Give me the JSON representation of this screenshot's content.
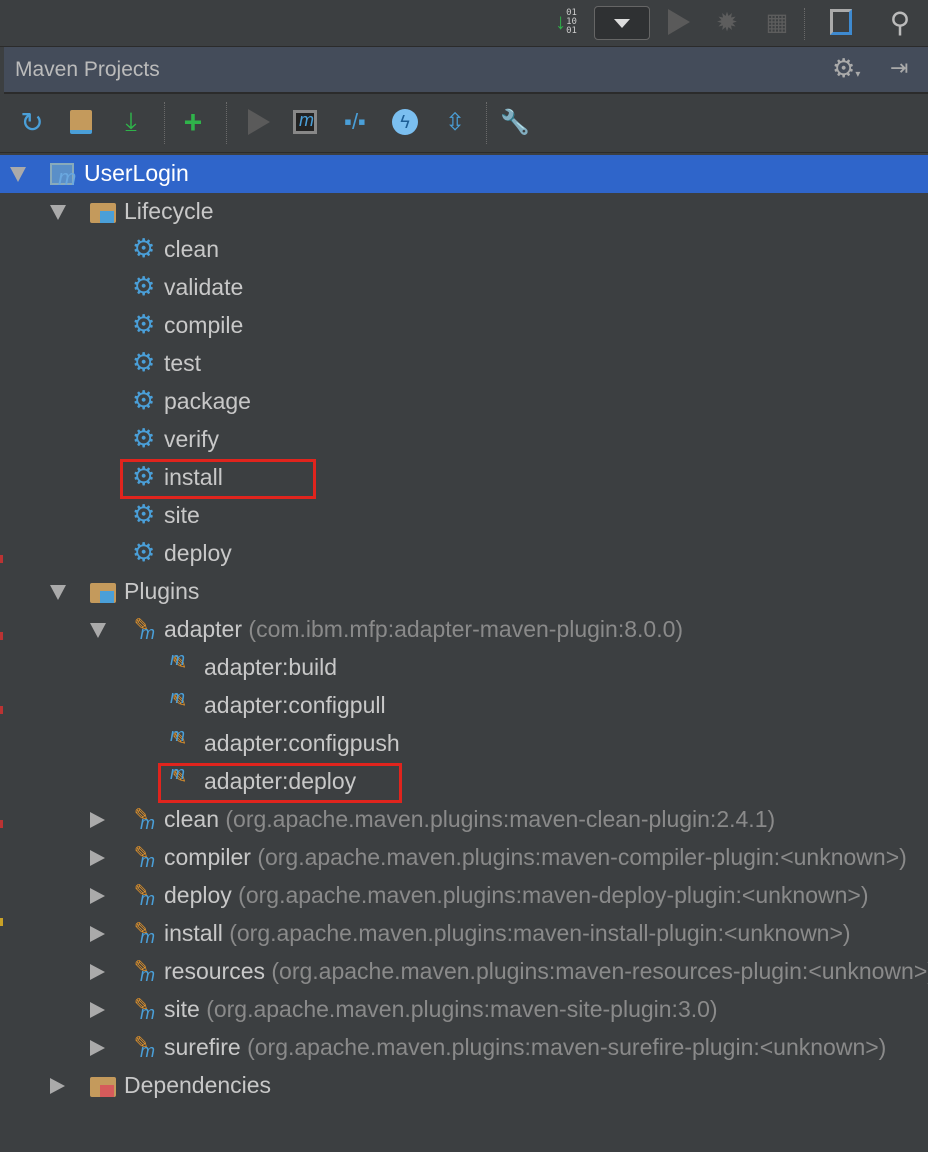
{
  "topbar": {
    "icons": [
      "download-binary-icon",
      "run-config-dropdown",
      "run-icon",
      "debug-icon",
      "coverage-icon",
      "project-structure-icon",
      "search-icon"
    ]
  },
  "panel": {
    "title": "Maven Projects",
    "header_icons": [
      "gear-icon",
      "hide-panel-icon"
    ]
  },
  "toolbar": {
    "icons": [
      "reimport-icon",
      "generate-sources-icon",
      "download-sources-icon",
      "add-project-icon",
      "run-build-icon",
      "execute-goal-icon",
      "toggle-offline-icon",
      "skip-tests-icon",
      "collapse-all-icon",
      "maven-settings-icon"
    ]
  },
  "tree": [
    {
      "label": "UserLogin",
      "level": 0,
      "arrow": "down",
      "icon": "maven-project-icon",
      "selected": true
    },
    {
      "label": "Lifecycle",
      "level": 1,
      "arrow": "down",
      "icon": "folder-gear-icon"
    },
    {
      "label": "clean",
      "level": 2,
      "icon": "gear-icon"
    },
    {
      "label": "validate",
      "level": 2,
      "icon": "gear-icon"
    },
    {
      "label": "compile",
      "level": 2,
      "icon": "gear-icon"
    },
    {
      "label": "test",
      "level": 2,
      "icon": "gear-icon"
    },
    {
      "label": "package",
      "level": 2,
      "icon": "gear-icon"
    },
    {
      "label": "verify",
      "level": 2,
      "icon": "gear-icon"
    },
    {
      "label": "install",
      "level": 2,
      "icon": "gear-icon",
      "highlighted": true
    },
    {
      "label": "site",
      "level": 2,
      "icon": "gear-icon"
    },
    {
      "label": "deploy",
      "level": 2,
      "icon": "gear-icon"
    },
    {
      "label": "Plugins",
      "level": 1,
      "arrow": "down",
      "icon": "folder-gear-icon"
    },
    {
      "label": "adapter",
      "detail": "(com.ibm.mfp:adapter-maven-plugin:8.0.0)",
      "level": 2,
      "arrow": "down",
      "icon": "plugin-icon"
    },
    {
      "label": "adapter:build",
      "level": 3,
      "icon": "goal-icon"
    },
    {
      "label": "adapter:configpull",
      "level": 3,
      "icon": "goal-icon"
    },
    {
      "label": "adapter:configpush",
      "level": 3,
      "icon": "goal-icon"
    },
    {
      "label": "adapter:deploy",
      "level": 3,
      "icon": "goal-icon",
      "highlighted": true
    },
    {
      "label": "clean",
      "detail": "(org.apache.maven.plugins:maven-clean-plugin:2.4.1)",
      "level": 2,
      "arrow": "right",
      "icon": "plugin-icon"
    },
    {
      "label": "compiler",
      "detail": "(org.apache.maven.plugins:maven-compiler-plugin:<unknown>)",
      "level": 2,
      "arrow": "right",
      "icon": "plugin-icon"
    },
    {
      "label": "deploy",
      "detail": "(org.apache.maven.plugins:maven-deploy-plugin:<unknown>)",
      "level": 2,
      "arrow": "right",
      "icon": "plugin-icon"
    },
    {
      "label": "install",
      "detail": "(org.apache.maven.plugins:maven-install-plugin:<unknown>)",
      "level": 2,
      "arrow": "right",
      "icon": "plugin-icon"
    },
    {
      "label": "resources",
      "detail": "(org.apache.maven.plugins:maven-resources-plugin:<unknown>)",
      "level": 2,
      "arrow": "right",
      "icon": "plugin-icon"
    },
    {
      "label": "site",
      "detail": "(org.apache.maven.plugins:maven-site-plugin:3.0)",
      "level": 2,
      "arrow": "right",
      "icon": "plugin-icon"
    },
    {
      "label": "surefire",
      "detail": "(org.apache.maven.plugins:maven-surefire-plugin:<unknown>)",
      "level": 2,
      "arrow": "right",
      "icon": "plugin-icon"
    },
    {
      "label": "Dependencies",
      "level": 1,
      "arrow": "right",
      "icon": "folder-dependencies-icon"
    }
  ],
  "colors": {
    "selection": "#2f65ca",
    "highlight": "#e0241d",
    "accent_blue": "#4a9fd8"
  }
}
